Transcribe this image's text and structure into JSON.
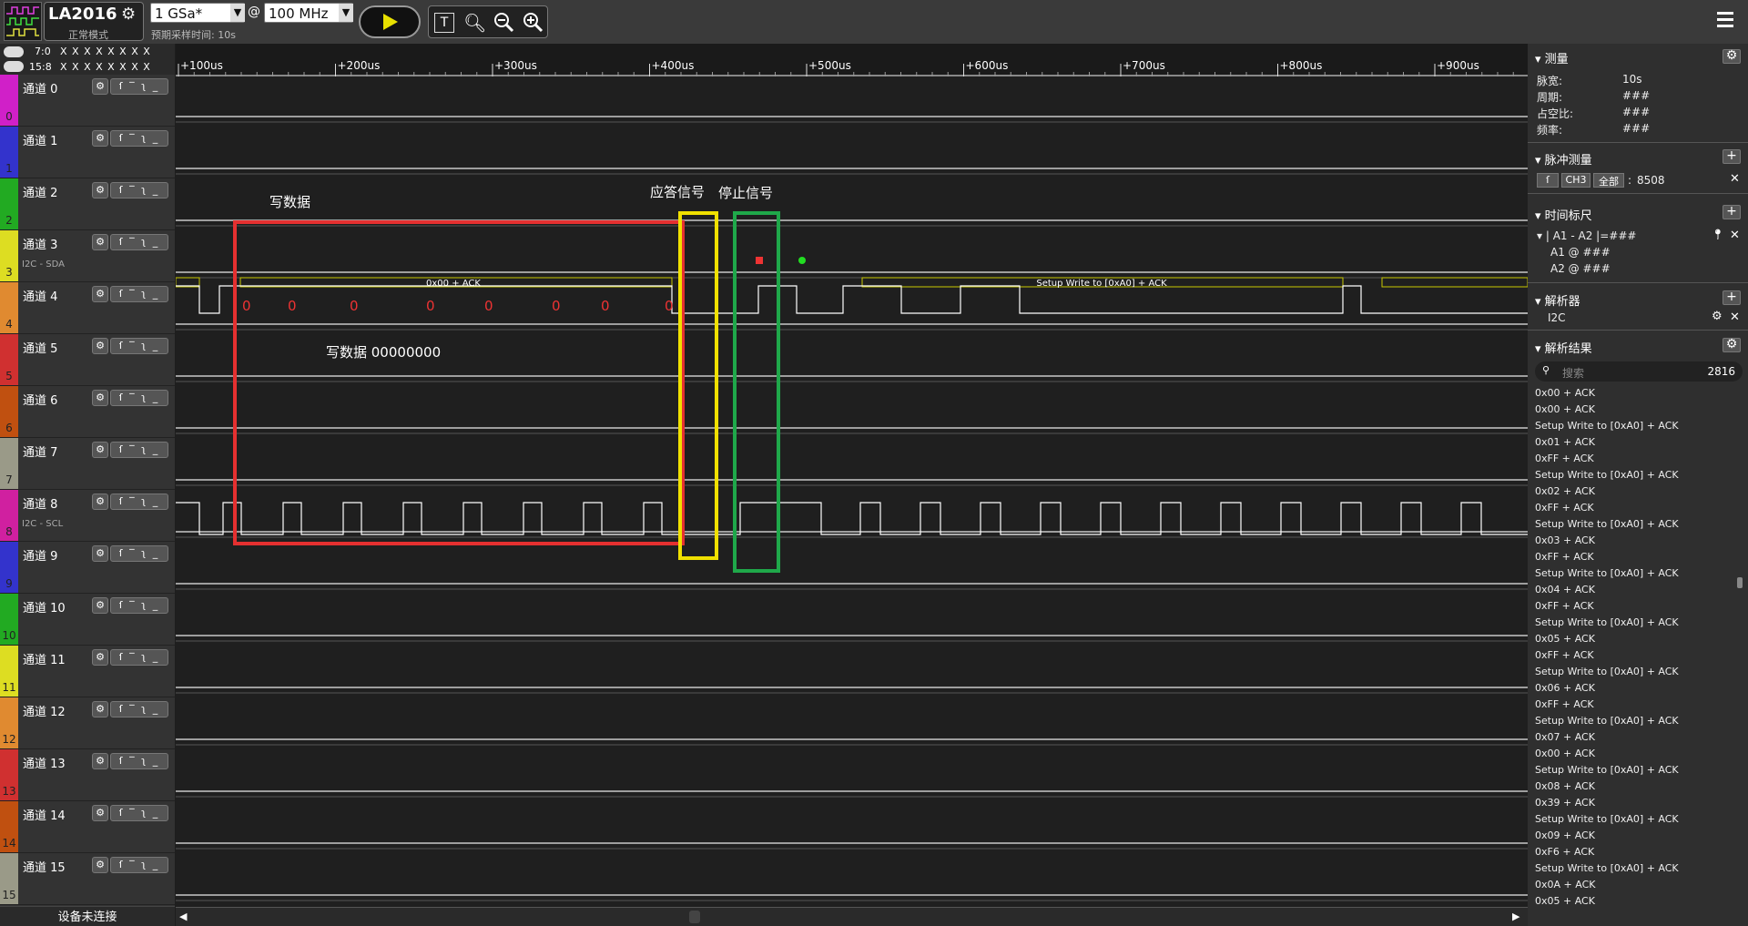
{
  "app": {
    "device": "LA2016",
    "mode": "正常模式",
    "sample_rate": "1 GSa*",
    "at": "@",
    "frequency": "100 MHz",
    "estimate_label": "预期采样时间: 10s"
  },
  "colors": {
    "accent": "#e8e000",
    "annot_red": "#e53030",
    "annot_yellow": "#f0e000",
    "annot_green": "#1fa84a",
    "wave": "#ffffff",
    "track": "#c8c8c8",
    "bus": "#c8c800"
  },
  "groups": [
    {
      "label": "7:0",
      "value": "X X X X X X X X"
    },
    {
      "label": "15:8",
      "value": "X X X X X X X X"
    }
  ],
  "channels": [
    {
      "name": "通道 0",
      "num": "0",
      "color": "#d020c8",
      "sub": ""
    },
    {
      "name": "通道 1",
      "num": "1",
      "color": "#3333cc",
      "sub": ""
    },
    {
      "name": "通道 2",
      "num": "2",
      "color": "#22aa22",
      "sub": ""
    },
    {
      "name": "通道 3",
      "num": "3",
      "color": "#dddd22",
      "sub": "I2C - SDA"
    },
    {
      "name": "通道 4",
      "num": "4",
      "color": "#e08a30",
      "sub": ""
    },
    {
      "name": "通道 5",
      "num": "5",
      "color": "#d03030",
      "sub": ""
    },
    {
      "name": "通道 6",
      "num": "6",
      "color": "#c05010",
      "sub": ""
    },
    {
      "name": "通道 7",
      "num": "7",
      "color": "#9a9a88",
      "sub": ""
    },
    {
      "name": "通道 8",
      "num": "8",
      "color": "#d020a0",
      "sub": "I2C - SCL"
    },
    {
      "name": "通道 9",
      "num": "9",
      "color": "#3333cc",
      "sub": ""
    },
    {
      "name": "通道 10",
      "num": "10",
      "color": "#22aa22",
      "sub": ""
    },
    {
      "name": "通道 11",
      "num": "11",
      "color": "#dddd22",
      "sub": ""
    },
    {
      "name": "通道 12",
      "num": "12",
      "color": "#e08a30",
      "sub": ""
    },
    {
      "name": "通道 13",
      "num": "13",
      "color": "#d03030",
      "sub": ""
    },
    {
      "name": "通道 14",
      "num": "14",
      "color": "#c05010",
      "sub": ""
    },
    {
      "name": "通道 15",
      "num": "15",
      "color": "#9a9a88",
      "sub": ""
    }
  ],
  "status": "设备未连接",
  "time_ticks": [
    "+100us",
    "+200us",
    "+300us",
    "+400us",
    "+500us",
    "+600us",
    "+700us",
    "+800us",
    "+900us"
  ],
  "annotations": {
    "write_data": "写数据",
    "ack_signal": "应答信号",
    "stop_signal": "停止信号",
    "write_data_bits": "写数据 00000000",
    "bit_zero": "0"
  },
  "bus_labels": {
    "first": "0x00 + ACK",
    "second": "Setup Write to [0xA0] + ACK"
  },
  "panel": {
    "measure": {
      "title": "测量",
      "rows": [
        {
          "k": "脉宽:",
          "v": "10s"
        },
        {
          "k": "周期:",
          "v": "###"
        },
        {
          "k": "占空比:",
          "v": "###"
        },
        {
          "k": "频率:",
          "v": "###"
        }
      ]
    },
    "pulse": {
      "title": "脉冲测量",
      "ch": "CH3",
      "all": "全部",
      "colon": ":",
      "count": "8508"
    },
    "ruler": {
      "title": "时间标尺",
      "expr": "A1 - A2 |=###",
      "a1": "A1 @ ###",
      "a2": "A2 @ ###"
    },
    "decoder": {
      "title": "解析器",
      "name": "I2C"
    },
    "results": {
      "title": "解析结果",
      "search_placeholder": "搜索",
      "count": "2816",
      "items": [
        "0x00 + ACK",
        "0x00 + ACK",
        "Setup Write to [0xA0] + ACK",
        "0x01 + ACK",
        "0xFF + ACK",
        "Setup Write to [0xA0] + ACK",
        "0x02 + ACK",
        "0xFF + ACK",
        "Setup Write to [0xA0] + ACK",
        "0x03 + ACK",
        "0xFF + ACK",
        "Setup Write to [0xA0] + ACK",
        "0x04 + ACK",
        "0xFF + ACK",
        "Setup Write to [0xA0] + ACK",
        "0x05 + ACK",
        "0xFF + ACK",
        "Setup Write to [0xA0] + ACK",
        "0x06 + ACK",
        "0xFF + ACK",
        "Setup Write to [0xA0] + ACK",
        "0x07 + ACK",
        "0x00 + ACK",
        "Setup Write to [0xA0] + ACK",
        "0x08 + ACK",
        "0x39 + ACK",
        "Setup Write to [0xA0] + ACK",
        "0x09 + ACK",
        "0xF6 + ACK",
        "Setup Write to [0xA0] + ACK",
        "0x0A + ACK",
        "0x05 + ACK"
      ]
    }
  }
}
